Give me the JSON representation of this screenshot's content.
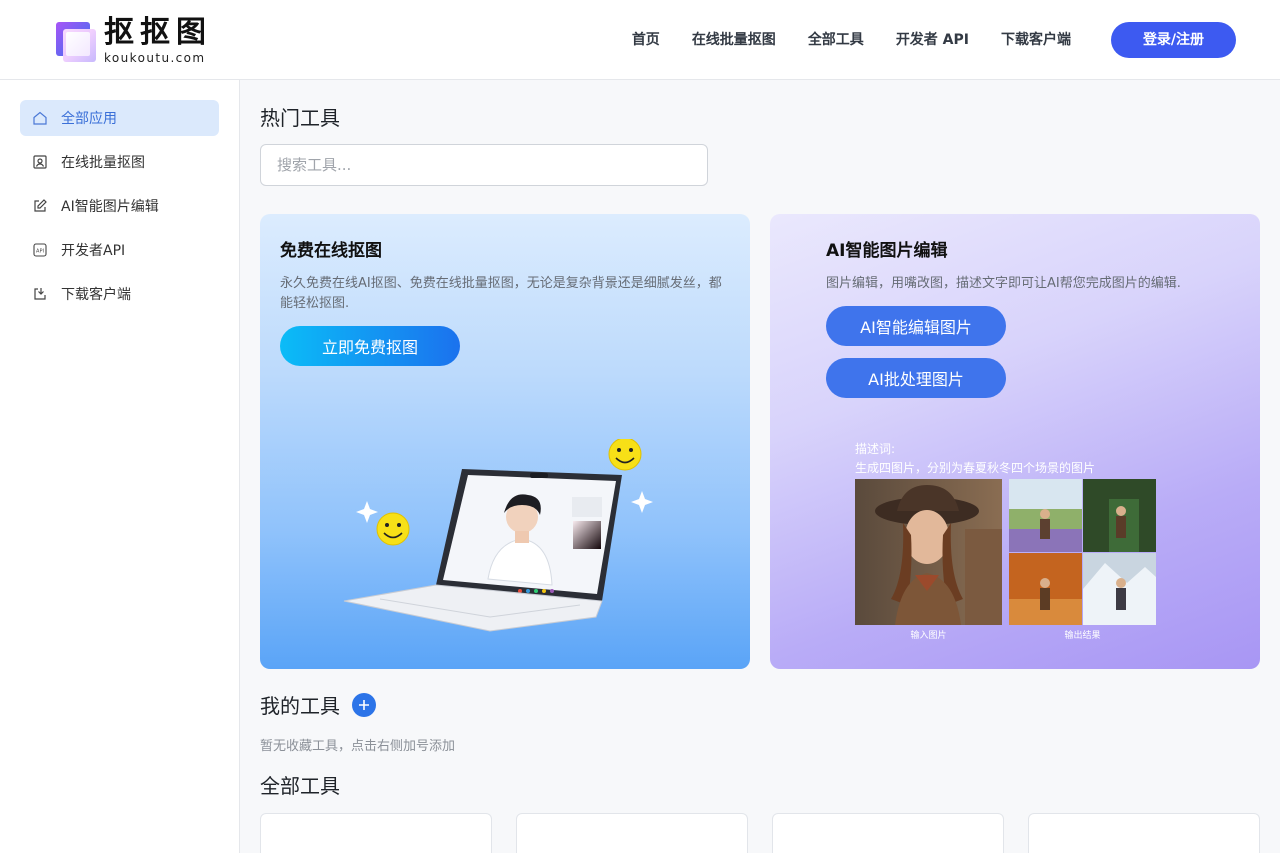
{
  "header": {
    "logo_cn": "抠抠图",
    "logo_en": "koukoutu.com",
    "nav": [
      "首页",
      "在线批量抠图",
      "全部工具",
      "开发者 API",
      "下载客户端"
    ],
    "login_label": "登录/注册"
  },
  "sidebar": {
    "items": [
      {
        "label": "全部应用",
        "icon": "home-icon",
        "active": true
      },
      {
        "label": "在线批量抠图",
        "icon": "portrait-icon",
        "active": false
      },
      {
        "label": "AI智能图片编辑",
        "icon": "edit-icon",
        "active": false
      },
      {
        "label": "开发者API",
        "icon": "api-icon",
        "active": false
      },
      {
        "label": "下载客户端",
        "icon": "download-icon",
        "active": false
      }
    ]
  },
  "main": {
    "hot_title": "热门工具",
    "search_placeholder": "搜索工具...",
    "card_left": {
      "title": "免费在线抠图",
      "desc": "永久免费在线AI抠图、免费在线批量抠图，无论是复杂背景还是细腻发丝，都能轻松抠图.",
      "cta": "立即免费抠图"
    },
    "card_right": {
      "title": "AI智能图片编辑",
      "desc": "图片编辑，用嘴改图，描述文字即可让AI帮您完成图片的编辑.",
      "cta1": "AI智能编辑图片",
      "cta2": "AI批处理图片",
      "prompt_label": "描述词:",
      "prompt_text": "生成四图片，分别为春夏秋冬四个场景的图片",
      "input_label": "输入图片",
      "output_label": "输出结果"
    },
    "my_tools_title": "我的工具",
    "empty_hint": "暂无收藏工具，点击右侧加号添加",
    "all_tools_title": "全部工具"
  },
  "colors": {
    "primary": "#3d5af1",
    "sidebar_active_bg": "#dbe9fc",
    "sidebar_active_text": "#3a6fd8"
  }
}
